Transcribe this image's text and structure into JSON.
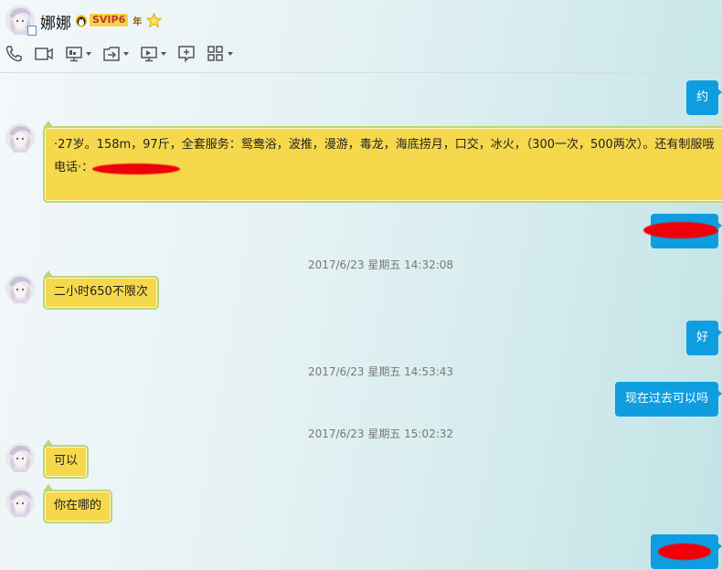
{
  "header": {
    "contact_name": "娜娜",
    "vip_label": "SVIP6",
    "year_label": "年"
  },
  "toolbar": {
    "items": [
      {
        "icon": "phone-icon",
        "has_dropdown": false
      },
      {
        "icon": "video-icon",
        "has_dropdown": false
      },
      {
        "icon": "screen-share-icon",
        "has_dropdown": true
      },
      {
        "icon": "file-transfer-icon",
        "has_dropdown": true
      },
      {
        "icon": "remote-desktop-icon",
        "has_dropdown": true
      },
      {
        "icon": "add-icon",
        "has_dropdown": false
      },
      {
        "icon": "apps-grid-icon",
        "has_dropdown": true
      }
    ]
  },
  "messages": [
    {
      "type": "out",
      "text": "约"
    },
    {
      "type": "in",
      "line1": "·27岁。158m，97斤，全套服务：鸳鸯浴，波推，漫游，毒龙，海底捞月，口交，冰火，（300一次，500两次）。还有制服哦",
      "line2": "电话·："
    },
    {
      "type": "out",
      "text": ""
    },
    {
      "type": "time",
      "text": "2017/6/23 星期五 14:32:08"
    },
    {
      "type": "in",
      "text": "二小时650不限次"
    },
    {
      "type": "out",
      "text": "好"
    },
    {
      "type": "time",
      "text": "2017/6/23 星期五 14:53:43"
    },
    {
      "type": "out",
      "text": "现在过去可以吗"
    },
    {
      "type": "time",
      "text": "2017/6/23 星期五 15:02:32"
    },
    {
      "type": "in",
      "text": "可以"
    },
    {
      "type": "in",
      "text": "你在哪的"
    },
    {
      "type": "out",
      "text": ""
    }
  ],
  "colors": {
    "incoming_bubble": "#f6d84d",
    "outgoing_bubble": "#0e9ee0",
    "redaction": "#f00008"
  }
}
